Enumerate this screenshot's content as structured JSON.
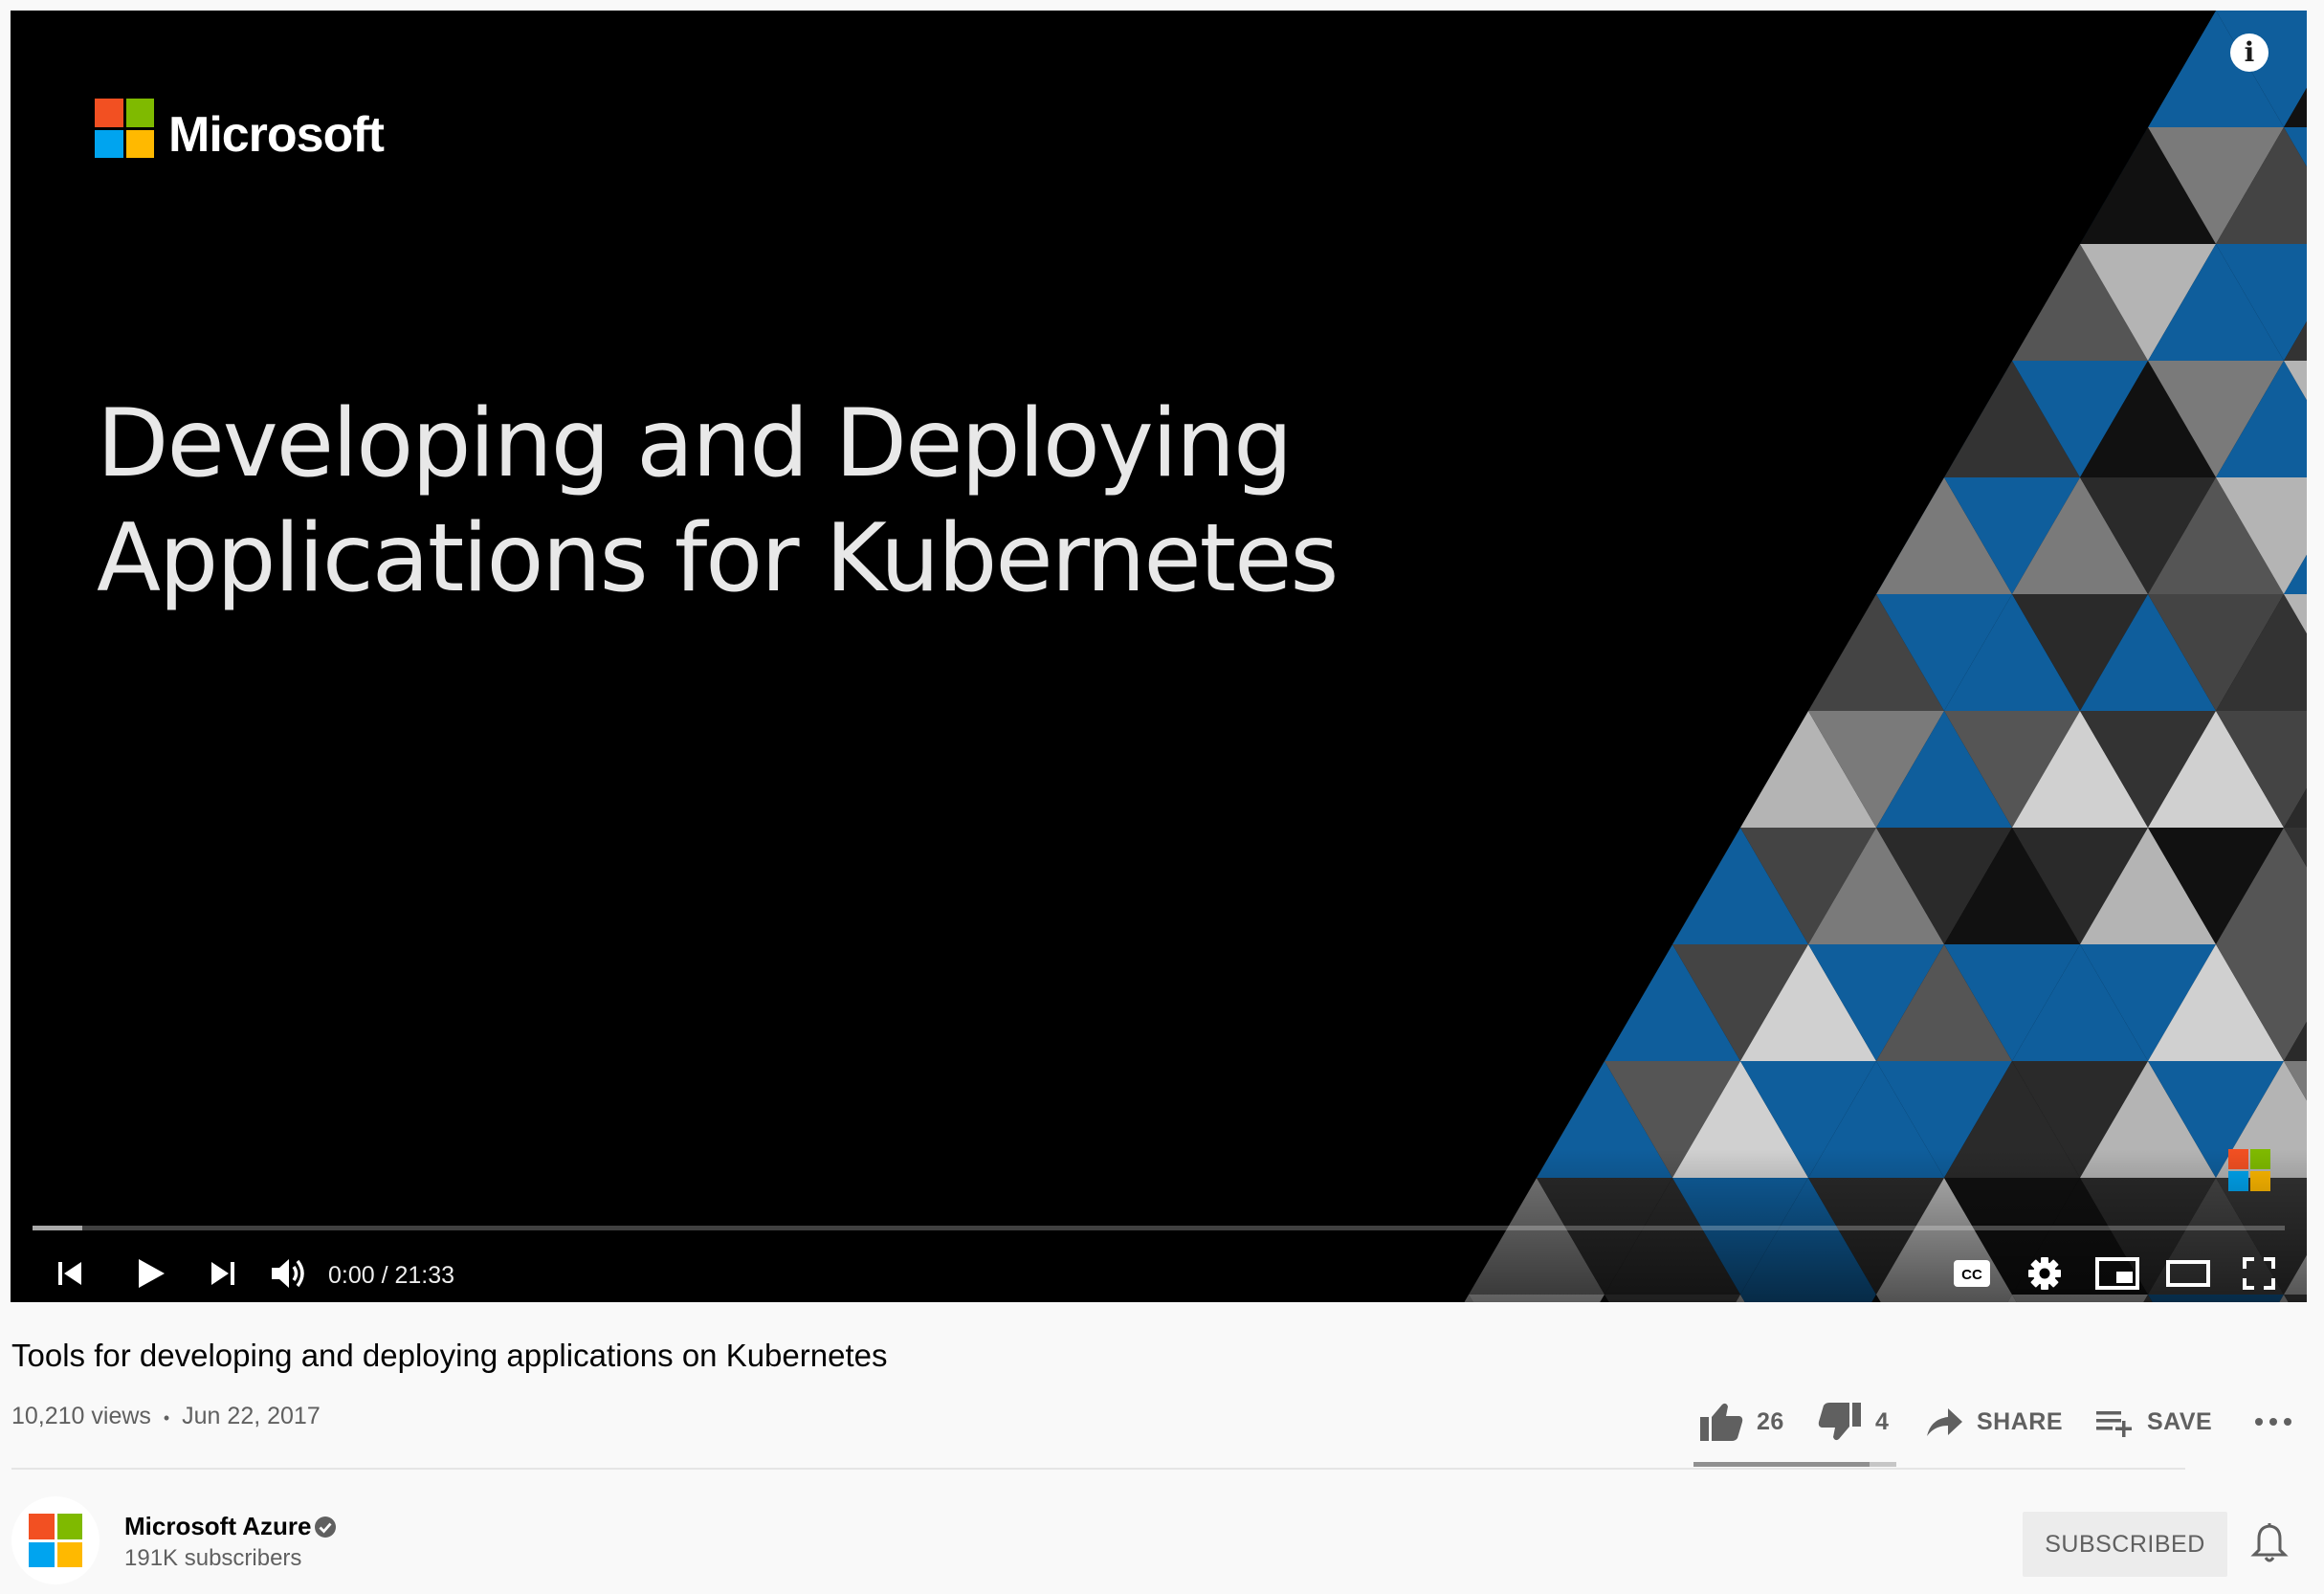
{
  "player": {
    "slide": {
      "brand": "Microsoft",
      "title_line1": "Developing and Deploying",
      "title_line2": "Applications for Kubernetes"
    },
    "info_icon": "i",
    "time_display": "0:00 / 21:33",
    "progress": {
      "played_fraction": 0.0,
      "buffered_fraction": 0.022
    },
    "icons": {
      "previous": "previous-icon",
      "play": "play-icon",
      "next": "next-icon",
      "volume": "volume-icon",
      "captions": "captions-icon",
      "settings": "settings-icon",
      "miniplayer": "miniplayer-icon",
      "theater": "theater-mode-icon",
      "fullscreen": "fullscreen-icon",
      "info": "info-icon"
    },
    "logo_colors": [
      "#f25022",
      "#7fba00",
      "#00a4ef",
      "#ffb900"
    ]
  },
  "video": {
    "title": "Tools for developing and deploying applications on Kubernetes",
    "views": "10,210 views",
    "separator": "•",
    "date": "Jun 22, 2017"
  },
  "actions": {
    "likes": "26",
    "dislikes": "4",
    "share_label": "SHARE",
    "save_label": "SAVE",
    "like_ratio": 0.867
  },
  "channel": {
    "name": "Microsoft Azure",
    "subscribers": "191K subscribers",
    "subscribe_label": "SUBSCRIBED"
  },
  "colors": {
    "triangle_blue": "#0f5e9c",
    "progress_red": "#ff0000",
    "text_secondary": "#606060"
  }
}
